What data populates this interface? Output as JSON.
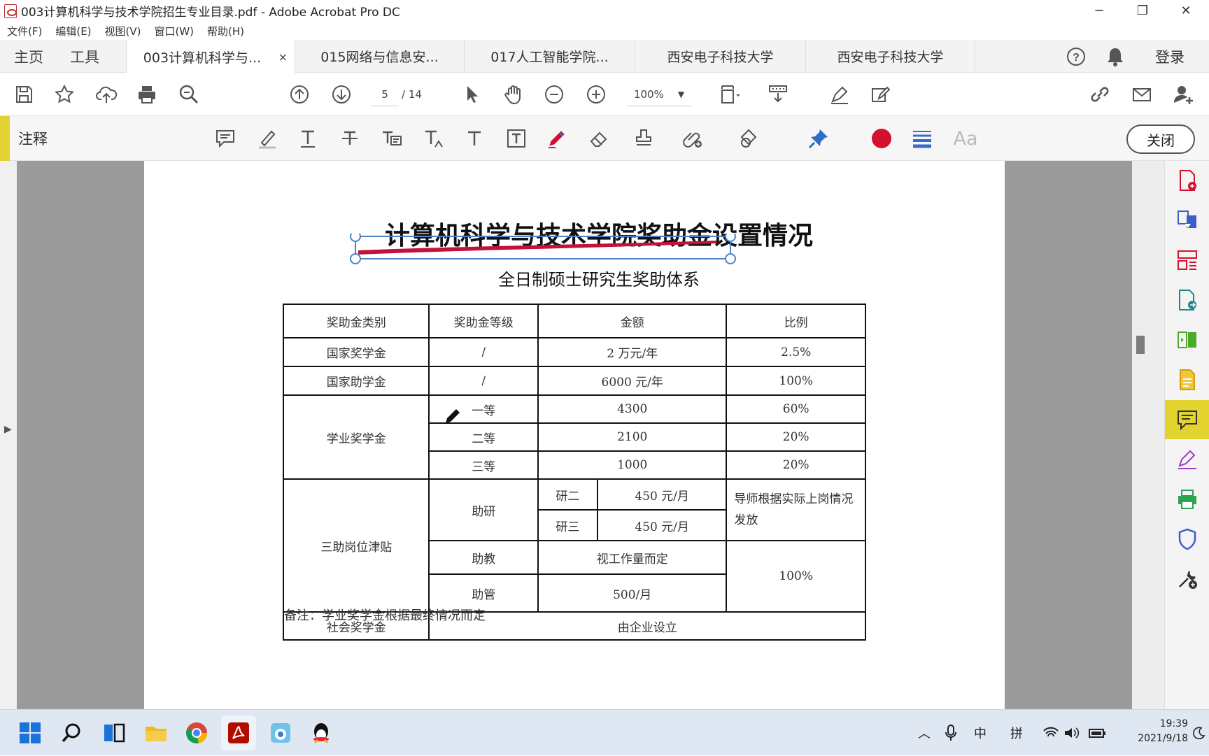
{
  "window": {
    "title": "003计算机科学与技术学院招生专业目录.pdf - Adobe Acrobat Pro DC",
    "minimize": "─",
    "maximize": "❐",
    "close": "✕"
  },
  "menu": [
    "文件(F)",
    "编辑(E)",
    "视图(V)",
    "窗口(W)",
    "帮助(H)"
  ],
  "tabs": {
    "home": "主页",
    "tools": "工具",
    "docs": [
      {
        "label": "003计算机科学与...",
        "close": "×"
      },
      {
        "label": "015网络与信息安..."
      },
      {
        "label": "017人工智能学院..."
      },
      {
        "label": "西安电子科技大学"
      },
      {
        "label": "西安电子科技大学"
      }
    ],
    "login": "登录"
  },
  "toolbar": {
    "page_current": "5",
    "page_total": "/ 14",
    "zoom": "100%"
  },
  "comment": {
    "label": "注释",
    "close": "关闭",
    "font_label": "Aa",
    "color": "#d4102f"
  },
  "document": {
    "title": "计算机科学与技术学院奖助金设置情况",
    "subtitle": "全日制硕士研究生奖助体系",
    "headers": [
      "奖助金类别",
      "奖助金等级",
      "金额",
      "比例"
    ],
    "rows": {
      "gj_name": "国家奖学金",
      "gj_level": "/",
      "gj_amount": "2 万元/年",
      "gj_ratio": "2.5%",
      "zx_name": "国家助学金",
      "zx_level": "/",
      "zx_amount": "6000 元/年",
      "zx_ratio": "100%",
      "xy_name": "学业奖学金",
      "xy1_level": "一等",
      "xy1_amount": "4300",
      "xy1_ratio": "60%",
      "xy2_level": "二等",
      "xy2_amount": "2100",
      "xy2_ratio": "20%",
      "xy3_level": "三等",
      "xy3_amount": "1000",
      "xy3_ratio": "20%",
      "sz_name": "三助岗位津贴",
      "zy_level": "助研",
      "zy2_sub": "研二",
      "zy2_amount": "450 元/月",
      "zy3_sub": "研三",
      "zy3_amount": "450 元/月",
      "zy_ratio": "导师根据实际上岗情况发放",
      "zj_level": "助教",
      "zj_amount": "视工作量而定",
      "zg_level": "助管",
      "zg_amount": "500/月",
      "sz_ratio": "100%",
      "sh_name": "社会奖学金",
      "sh_value": "由企业设立"
    },
    "note": "备注：学业奖学金根据最终情况而定"
  },
  "taskbar": {
    "ime1": "中",
    "ime2": "拼",
    "time": "19:39",
    "date": "2021/9/18"
  }
}
